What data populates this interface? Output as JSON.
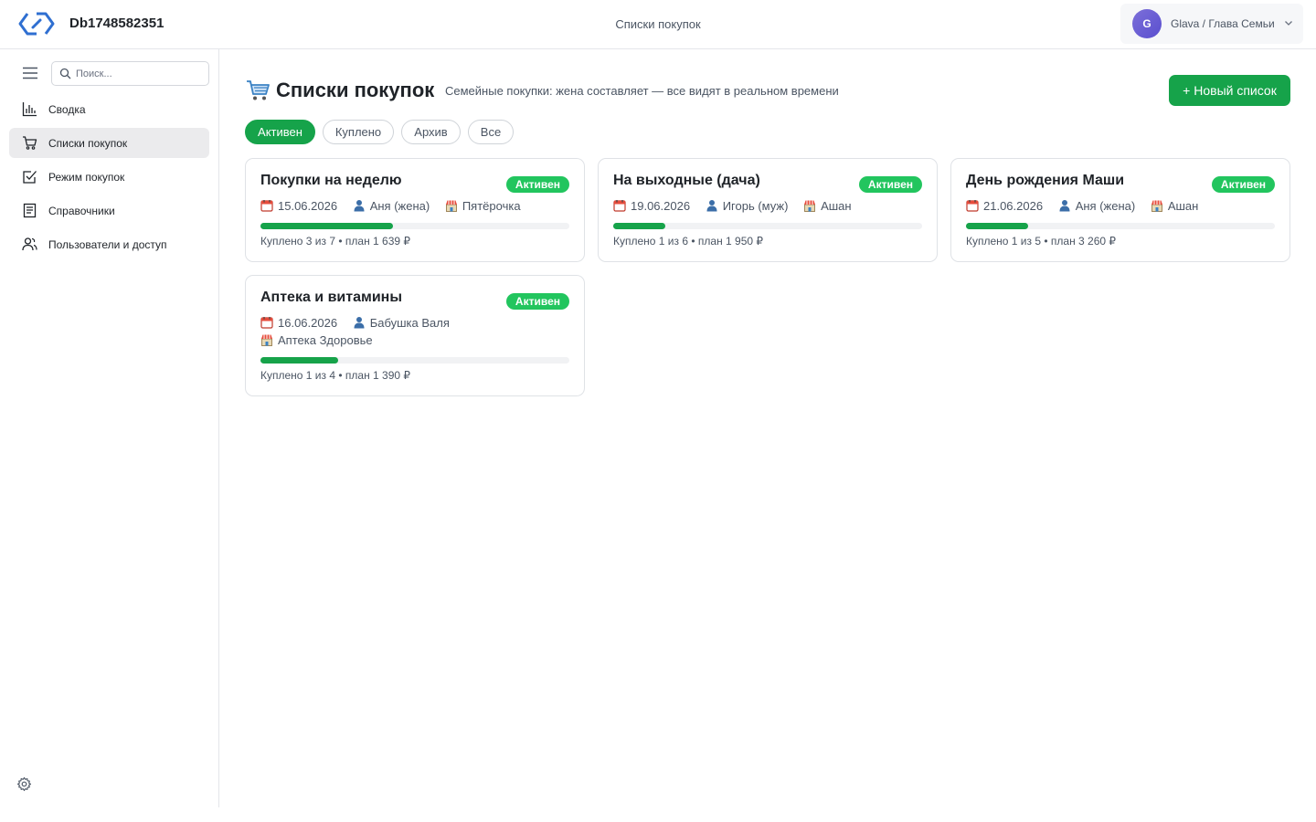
{
  "app": {
    "brand": "Db1748582351",
    "page_title": "Списки покупок",
    "user_initial": "G",
    "user_label": "Glava / Глава Семьи"
  },
  "sidebar": {
    "search_placeholder": "Поиск...",
    "items": [
      {
        "label": "Сводка",
        "icon": "bar-chart-icon",
        "active": false
      },
      {
        "label": "Списки покупок",
        "icon": "cart-icon",
        "active": true
      },
      {
        "label": "Режим покупок",
        "icon": "checkbox-icon",
        "active": false
      },
      {
        "label": "Справочники",
        "icon": "book-icon",
        "active": false
      },
      {
        "label": "Пользователи и доступ",
        "icon": "users-icon",
        "active": false
      }
    ]
  },
  "main": {
    "title": "Списки покупок",
    "subtitle": "Семейные покупки: жена составляет — все видят в реальном времени",
    "new_button": "+ Новый список",
    "filters": [
      {
        "label": "Активен",
        "active": true
      },
      {
        "label": "Куплено",
        "active": false
      },
      {
        "label": "Архив",
        "active": false
      },
      {
        "label": "Все",
        "active": false
      }
    ],
    "lists": [
      {
        "title": "Покупки на неделю",
        "status": "Активен",
        "date": "15.06.2026",
        "person": "Аня (жена)",
        "store": "Пятёрочка",
        "summary": "Куплено 3 из 7 • план 1 639 ₽",
        "progress": 0.43
      },
      {
        "title": "На выходные (дача)",
        "status": "Активен",
        "date": "19.06.2026",
        "person": "Игорь (муж)",
        "store": "Ашан",
        "summary": "Куплено 1 из 6 • план 1 950 ₽",
        "progress": 0.17
      },
      {
        "title": "День рождения Маши",
        "status": "Активен",
        "date": "21.06.2026",
        "person": "Аня (жена)",
        "store": "Ашан",
        "summary": "Куплено 1 из 5 • план 3 260 ₽",
        "progress": 0.2
      },
      {
        "title": "Аптека и витамины",
        "status": "Активен",
        "date": "16.06.2026",
        "person": "Бабушка Валя",
        "store": "Аптека Здоровье",
        "summary": "Куплено 1 из 4 • план 1 390 ₽",
        "progress": 0.25
      }
    ]
  },
  "colors": {
    "accent": "#16a34a",
    "badge": "#22c55e"
  }
}
